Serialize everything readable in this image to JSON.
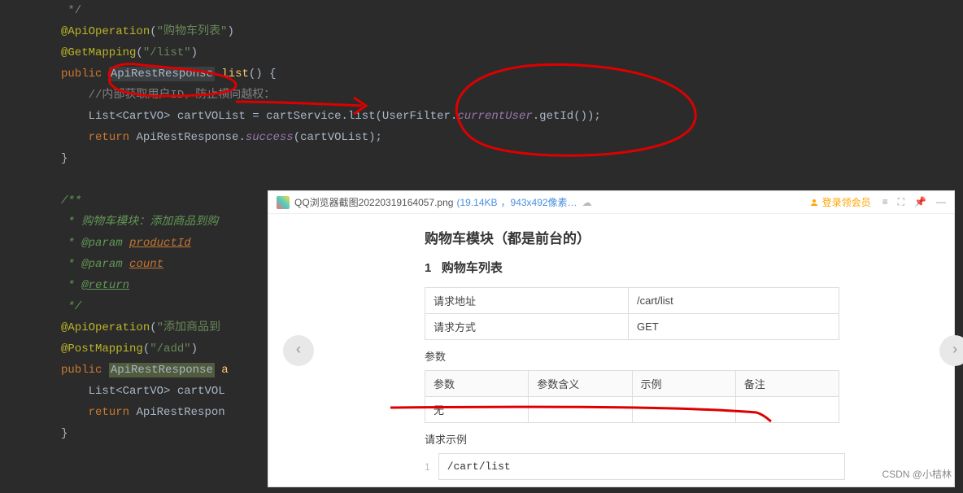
{
  "code": {
    "line0": " */",
    "annotation1": "@ApiOperation",
    "string1": "\"购物车列表\"",
    "annotation2": "@GetMapping",
    "string2": "\"/list\"",
    "keyword_public": "public",
    "class_apirest": "ApiRestResponse",
    "method_list": "list",
    "comment_inner": "//内部获取用户ID，防止横向越权：",
    "list_type": "List<CartVO>",
    "cartvolist": "cartVOList",
    "cartservice": "cartService",
    "list_call": "list",
    "userfilter": "UserFilter",
    "currentuser": "currentUser",
    "getid": "getId",
    "keyword_return": "return",
    "success": "success",
    "doc_start": "/**",
    "doc_line1": " * 购物车模块：添加商品到购",
    "doc_param": "@param",
    "doc_param1": "productId",
    "doc_param2": "count",
    "doc_return": "@return",
    "doc_end": " */",
    "annotation3": "@ApiOperation",
    "string3": "\"添加商品到",
    "annotation4": "@PostMapping",
    "string4": "\"/add\"",
    "method_a": "a",
    "cartvol2": "cartVOL",
    "apirestrespon": "ApiRestRespon"
  },
  "preview": {
    "filename": "QQ浏览器截图20220319164057.png",
    "filesize": "(19.14KB",
    "dims": "，943x492像素…",
    "login_text": "登录领会员",
    "title": "购物车模块（都是前台的）",
    "section_num": "1",
    "section_title": "购物车列表",
    "req_url_label": "请求地址",
    "req_url_value": "/cart/list",
    "req_method_label": "请求方式",
    "req_method_value": "GET",
    "params_label": "参数",
    "param_headers": [
      "参数",
      "参数含义",
      "示例",
      "备注"
    ],
    "param_row_empty": "无",
    "example_label": "请求示例",
    "example_value": "/cart/list"
  },
  "watermark": "CSDN @小桔林"
}
